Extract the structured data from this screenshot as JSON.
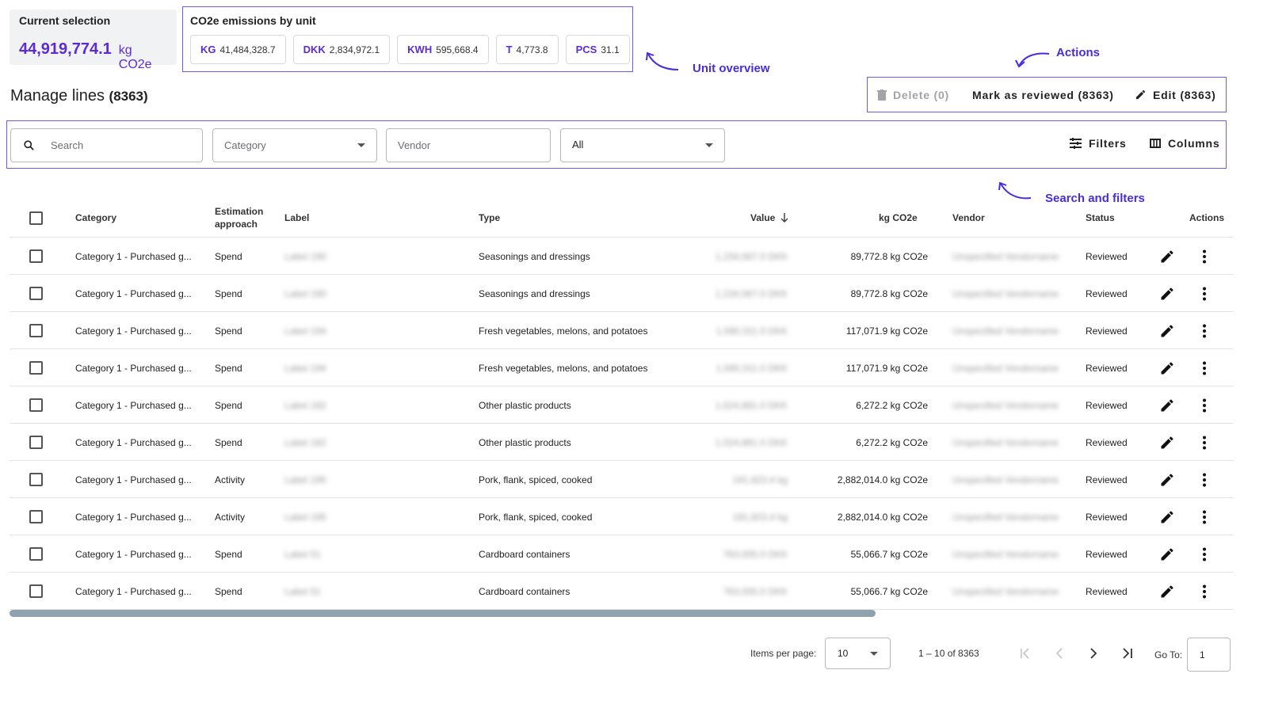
{
  "current_selection": {
    "title": "Current selection",
    "value": "44,919,774.1",
    "unit": "kg CO2e"
  },
  "emissions_by_unit": {
    "title": "CO2e emissions by unit",
    "chips": [
      {
        "unit": "KG",
        "value": "41,484,328.7"
      },
      {
        "unit": "DKK",
        "value": "2,834,972.1"
      },
      {
        "unit": "KWH",
        "value": "595,668.4"
      },
      {
        "unit": "T",
        "value": "4,773.8"
      },
      {
        "unit": "PCS",
        "value": "31.1"
      }
    ]
  },
  "annotations": {
    "unit_overview": "Unit overview",
    "actions": "Actions",
    "search_filters": "Search and filters"
  },
  "manage": {
    "title": "Manage lines",
    "count": "(8363)"
  },
  "actions": {
    "delete": "Delete (0)",
    "mark_reviewed": "Mark as reviewed (8363)",
    "edit": "Edit (8363)"
  },
  "filters": {
    "search_placeholder": "Search",
    "category_placeholder": "Category",
    "vendor_placeholder": "Vendor",
    "status_selected": "All",
    "filters_label": "Filters",
    "columns_label": "Columns"
  },
  "table": {
    "headers": {
      "category": "Category",
      "estimation_line1": "Estimation",
      "estimation_line2": "approach",
      "label": "Label",
      "type": "Type",
      "value": "Value",
      "kg": "kg CO2e",
      "vendor": "Vendor",
      "status": "Status",
      "actions": "Actions"
    },
    "rows": [
      {
        "category": "Category 1 - Purchased g...",
        "approach": "Spend",
        "label": "Label 190",
        "type": "Seasonings and dressings",
        "value": "1,234,567.0 DKK",
        "kg": "89,772.8 kg CO2e",
        "vendor": "Unspecified Vendorname",
        "status": "Reviewed"
      },
      {
        "category": "Category 1 - Purchased g...",
        "approach": "Spend",
        "label": "Label 190",
        "type": "Seasonings and dressings",
        "value": "1,234,567.0 DKK",
        "kg": "89,772.8 kg CO2e",
        "vendor": "Unspecified Vendorname",
        "status": "Reviewed"
      },
      {
        "category": "Category 1 - Purchased g...",
        "approach": "Spend",
        "label": "Label 194",
        "type": "Fresh vegetables, melons, and potatoes",
        "value": "1,590,311.0 DKK",
        "kg": "117,071.9 kg CO2e",
        "vendor": "Unspecified Vendorname",
        "status": "Reviewed"
      },
      {
        "category": "Category 1 - Purchased g...",
        "approach": "Spend",
        "label": "Label 194",
        "type": "Fresh vegetables, melons, and potatoes",
        "value": "1,590,311.0 DKK",
        "kg": "117,071.9 kg CO2e",
        "vendor": "Unspecified Vendorname",
        "status": "Reviewed"
      },
      {
        "category": "Category 1 - Purchased g...",
        "approach": "Spend",
        "label": "Label 182",
        "type": "Other plastic products",
        "value": "1,024,881.0 DKK",
        "kg": "6,272.2 kg CO2e",
        "vendor": "Unspecified Vendorname",
        "status": "Reviewed"
      },
      {
        "category": "Category 1 - Purchased g...",
        "approach": "Spend",
        "label": "Label 182",
        "type": "Other plastic products",
        "value": "1,024,881.0 DKK",
        "kg": "6,272.2 kg CO2e",
        "vendor": "Unspecified Vendorname",
        "status": "Reviewed"
      },
      {
        "category": "Category 1 - Purchased g...",
        "approach": "Activity",
        "label": "Label 195",
        "type": "Pork, flank, spiced, cooked",
        "value": "191,823.4 kg",
        "kg": "2,882,014.0 kg CO2e",
        "vendor": "Unspecified Vendorname",
        "status": "Reviewed"
      },
      {
        "category": "Category 1 - Purchased g...",
        "approach": "Activity",
        "label": "Label 195",
        "type": "Pork, flank, spiced, cooked",
        "value": "191,823.4 kg",
        "kg": "2,882,014.0 kg CO2e",
        "vendor": "Unspecified Vendorname",
        "status": "Reviewed"
      },
      {
        "category": "Category 1 - Purchased g...",
        "approach": "Spend",
        "label": "Label 51",
        "type": "Cardboard containers",
        "value": "763,005.0 DKK",
        "kg": "55,066.7 kg CO2e",
        "vendor": "Unspecified Vendorname",
        "status": "Reviewed"
      },
      {
        "category": "Category 1 - Purchased g...",
        "approach": "Spend",
        "label": "Label 51",
        "type": "Cardboard containers",
        "value": "763,005.0 DKK",
        "kg": "55,066.7 kg CO2e",
        "vendor": "Unspecified Vendorname",
        "status": "Reviewed"
      }
    ]
  },
  "pagination": {
    "items_per_page_label": "Items per page:",
    "items_per_page": "10",
    "range": "1 – 10 of 8363",
    "goto_label": "Go To:",
    "goto_value": "1"
  },
  "colors": {
    "accent": "#5b2bd6",
    "annotation": "#4a2cde",
    "border_highlight": "#6d5ee8"
  }
}
